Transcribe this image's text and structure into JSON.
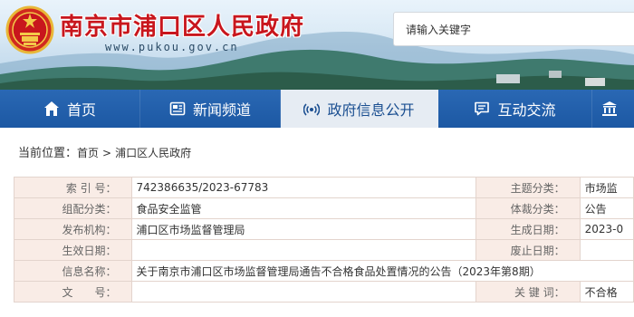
{
  "header": {
    "site_title": "南京市浦口区人民政府",
    "site_domain": "www.pukou.gov.cn",
    "search_placeholder": "请输入关键字"
  },
  "nav": {
    "items": [
      {
        "label": "首页",
        "icon": "home-icon",
        "active": false
      },
      {
        "label": "新闻频道",
        "icon": "newspaper-icon",
        "active": false
      },
      {
        "label": "政府信息公开",
        "icon": "broadcast-icon",
        "active": true
      },
      {
        "label": "互动交流",
        "icon": "chat-icon",
        "active": false
      },
      {
        "label": "",
        "icon": "building-icon",
        "active": false
      }
    ]
  },
  "breadcrumb": {
    "prefix": "当前位置：",
    "items": [
      "首页",
      "浦口区人民政府"
    ],
    "separator": ">"
  },
  "info": {
    "index_label": "索 引 号：",
    "index_value": "742386635/2023-67783",
    "topic_label": "主题分类：",
    "topic_value": "市场监",
    "org_type_label": "组配分类：",
    "org_type_value": "食品安全监管",
    "genre_label": "体裁分类：",
    "genre_value": "公告",
    "publisher_label": "发布机构：",
    "publisher_value": "浦口区市场监督管理局",
    "created_label": "生成日期：",
    "created_value": "2023-0",
    "effective_label": "生效日期：",
    "effective_value": "",
    "repeal_label": "废止日期：",
    "repeal_value": "",
    "name_label": "信息名称：",
    "name_value": "关于南京市浦口区市场监督管理局通告不合格食品处置情况的公告（2023年第8期）",
    "doc_no_label": "文　　号：",
    "doc_no_value": "",
    "keywords_label": "关 键 词：",
    "keywords_value": "不合格"
  },
  "colors": {
    "nav_bg": "#1c58a3",
    "nav_active_bg": "#e6ecf3",
    "title_red": "#c8161d",
    "label_bg": "#f9ece6",
    "table_border": "#e3d4cd"
  }
}
